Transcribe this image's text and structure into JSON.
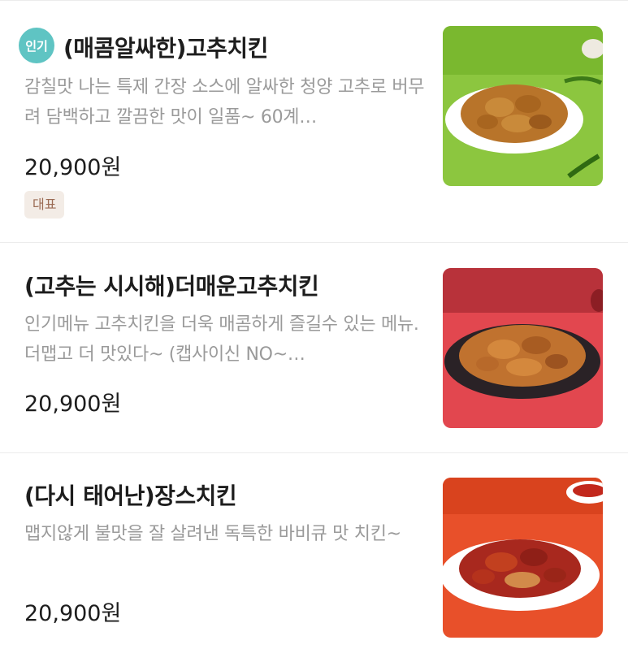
{
  "menu_items": [
    {
      "badge": "인기",
      "name": "(매콤알싸한)고추치킨",
      "description": "감칠맛 나는 특제 간장 소스에 알싸한 청양 고추로 버무려 담백하고 깔끔한 맛이 일품~ 60계…",
      "price": "20,900원",
      "tag": "대표",
      "image_icon": "chicken-photo-green"
    },
    {
      "name": "(고추는 시시해)더매운고추치킨",
      "description": "인기메뉴 고추치킨을 더욱 매콤하게 즐길수 있는 메뉴. 더맵고 더 맛있다~ (캡사이신 NO~…",
      "price": "20,900원",
      "image_icon": "chicken-photo-red"
    },
    {
      "name": "(다시 태어난)장스치킨",
      "description": "맵지않게 불맛을 잘 살려낸 독특한 바비큐 맛 치킨~",
      "price": "20,900원",
      "image_icon": "chicken-photo-orange"
    }
  ],
  "colors": {
    "badge_bg": "#5fc4c3",
    "tag_bg": "#f3ece6",
    "tag_text": "#9b6b54"
  }
}
